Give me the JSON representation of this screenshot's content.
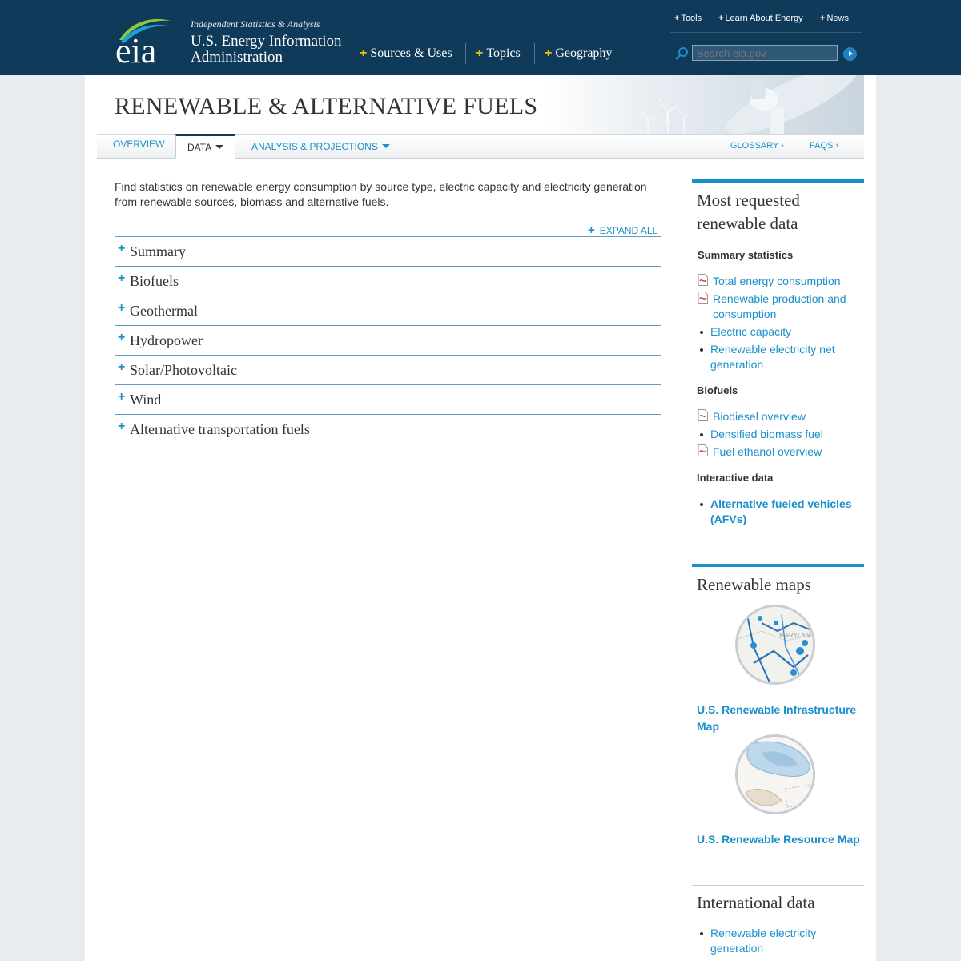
{
  "header": {
    "tagline": "Independent Statistics & Analysis",
    "org_line1": "U.S. Energy Information",
    "org_line2": "Administration",
    "logo_text": "eia",
    "nav": [
      "Sources & Uses",
      "Topics",
      "Geography"
    ],
    "utility": [
      "Tools",
      "Learn About Energy",
      "News"
    ],
    "search_placeholder": "Search eia.gov",
    "colors": {
      "background": "#0f3a5a",
      "accent": "#f2c200"
    }
  },
  "page": {
    "title": "RENEWABLE & ALTERNATIVE FUELS",
    "tabs": [
      {
        "label": "OVERVIEW"
      },
      {
        "label": "DATA"
      },
      {
        "label": "ANALYSIS & PROJECTIONS"
      }
    ],
    "right_links": [
      "GLOSSARY ›",
      "FAQS ›"
    ],
    "intro": "Find statistics on renewable energy consumption by source type, electric capacity and electricity generation from renewable sources, biomass and alternative fuels.",
    "expand_all": "EXPAND ALL",
    "sections": [
      "Summary",
      "Biofuels",
      "Geothermal",
      "Hydropower",
      "Solar/Photovoltaic",
      "Wind",
      "Alternative transportation fuels"
    ]
  },
  "sidebar": {
    "most_requested": {
      "heading": "Most requested renewable data",
      "groups": [
        {
          "title": "Summary statistics",
          "items": [
            {
              "label": "Total energy consumption",
              "icon": "pdf-icon"
            },
            {
              "label": "Renewable production and consumption",
              "icon": "pdf-icon"
            },
            {
              "label": "Electric capacity",
              "icon": "bullet"
            },
            {
              "label": "Renewable electricity net generation",
              "icon": "bullet"
            }
          ]
        },
        {
          "title": "Biofuels",
          "items": [
            {
              "label": "Biodiesel overview",
              "icon": "pdf-icon"
            },
            {
              "label": "Densified biomass fuel",
              "icon": "bullet"
            },
            {
              "label": "Fuel ethanol overview",
              "icon": "pdf-icon"
            }
          ]
        },
        {
          "title": "Interactive data",
          "items": [
            {
              "label": "Alternative fueled vehicles (AFVs)",
              "icon": "bullet"
            }
          ]
        }
      ]
    },
    "maps": {
      "heading": "Renewable maps",
      "items": [
        "U.S. Renewable Infrastructure Map",
        "U.S. Renewable Resource Map"
      ],
      "map_label": "MARYLAN"
    },
    "international": {
      "heading": "International data",
      "items": [
        "Renewable electricity generation"
      ]
    }
  }
}
